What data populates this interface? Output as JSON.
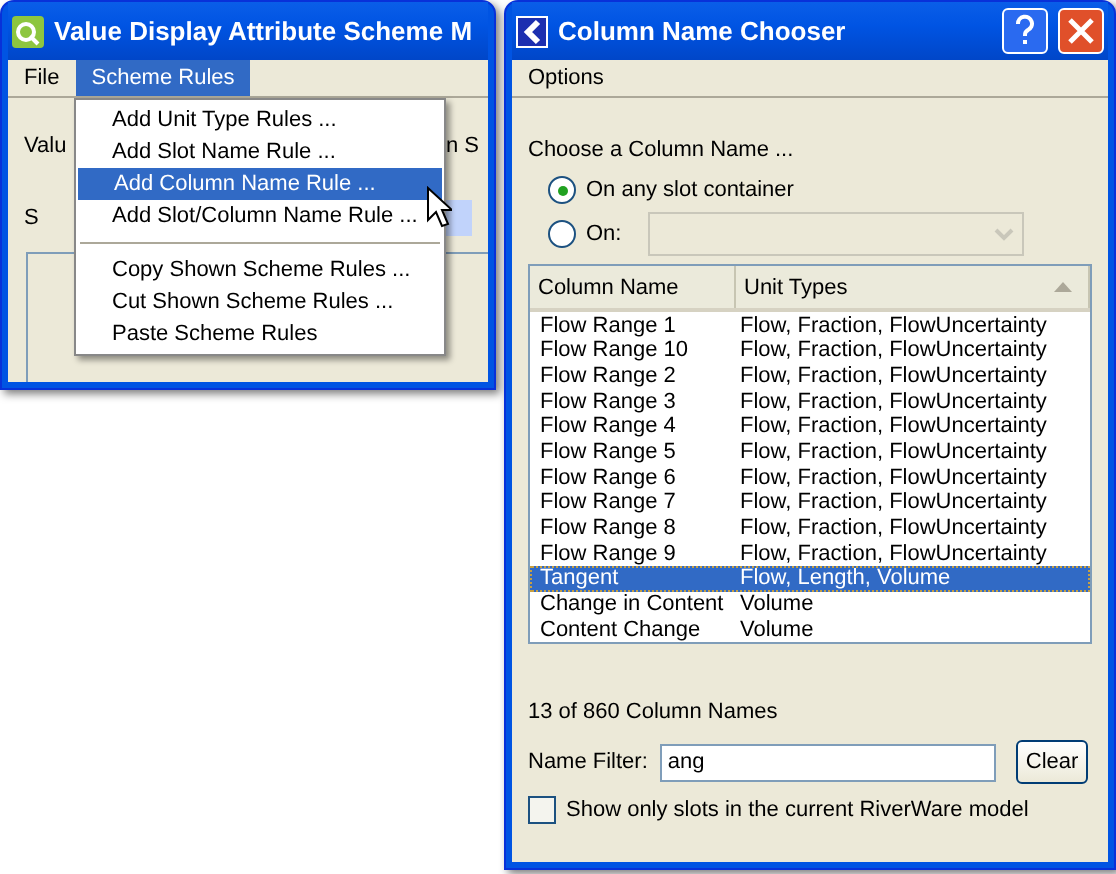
{
  "left_window": {
    "title": "Value Display Attribute Scheme M",
    "menu": [
      {
        "label": "File",
        "selected": false
      },
      {
        "label": "Scheme Rules",
        "selected": true
      }
    ],
    "background_labels": [
      "Valu",
      "n S",
      "S"
    ],
    "dropdown": [
      {
        "kind": "item",
        "label": "Add Unit Type Rules ...",
        "selected": false
      },
      {
        "kind": "item",
        "label": "Add Slot Name Rule ...",
        "selected": false
      },
      {
        "kind": "item",
        "label": "Add Column Name Rule ...",
        "selected": true
      },
      {
        "kind": "item",
        "label": "Add Slot/Column Name Rule ...",
        "selected": false
      },
      {
        "kind": "separator"
      },
      {
        "kind": "item",
        "label": "Copy Shown Scheme Rules ...",
        "selected": false
      },
      {
        "kind": "item",
        "label": "Cut Shown Scheme Rules ...",
        "selected": false
      },
      {
        "kind": "item",
        "label": "Paste Scheme Rules",
        "selected": false
      }
    ]
  },
  "right_window": {
    "title": "Column Name Chooser",
    "menu": [
      "Options"
    ],
    "prompt": "Choose a Column Name ...",
    "radios": [
      {
        "label": "On any slot container",
        "selected": true,
        "kind": "plain"
      },
      {
        "label": "On:",
        "selected": false,
        "kind": "combo"
      }
    ],
    "table": {
      "columns": [
        "Column Name",
        "Unit Types"
      ],
      "rows": [
        {
          "name": "Flow Range 1",
          "units": "Flow, Fraction, FlowUncertainty",
          "selected": false
        },
        {
          "name": "Flow Range 10",
          "units": "Flow, Fraction, FlowUncertainty",
          "selected": false
        },
        {
          "name": "Flow Range 2",
          "units": "Flow, Fraction, FlowUncertainty",
          "selected": false
        },
        {
          "name": "Flow Range 3",
          "units": "Flow, Fraction, FlowUncertainty",
          "selected": false
        },
        {
          "name": "Flow Range 4",
          "units": "Flow, Fraction, FlowUncertainty",
          "selected": false
        },
        {
          "name": "Flow Range 5",
          "units": "Flow, Fraction, FlowUncertainty",
          "selected": false
        },
        {
          "name": "Flow Range 6",
          "units": "Flow, Fraction, FlowUncertainty",
          "selected": false
        },
        {
          "name": "Flow Range 7",
          "units": "Flow, Fraction, FlowUncertainty",
          "selected": false
        },
        {
          "name": "Flow Range 8",
          "units": "Flow, Fraction, FlowUncertainty",
          "selected": false
        },
        {
          "name": "Flow Range 9",
          "units": "Flow, Fraction, FlowUncertainty",
          "selected": false
        },
        {
          "name": "Tangent",
          "units": "Flow, Length, Volume",
          "selected": true
        },
        {
          "name": "Change in Content",
          "units": "Volume",
          "selected": false
        },
        {
          "name": "Content Change",
          "units": "Volume",
          "selected": false
        }
      ]
    },
    "count": "13 of 860 Column Names",
    "filter": {
      "label": "Name Filter:",
      "value": "ang",
      "button": "Clear"
    },
    "checkbox": {
      "label": "Show only slots in the current RiverWare model",
      "checked": false
    }
  }
}
